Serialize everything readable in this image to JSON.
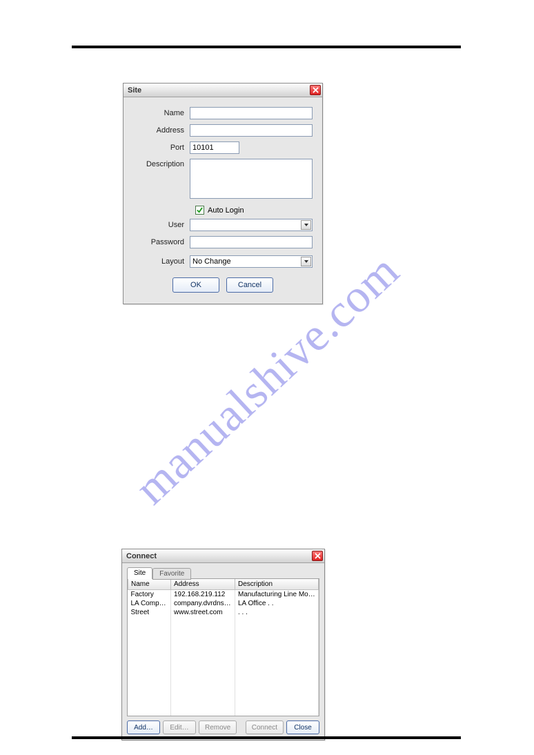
{
  "watermark": "manualshive.com",
  "site_dialog": {
    "title": "Site",
    "labels": {
      "name": "Name",
      "address": "Address",
      "port": "Port",
      "description": "Description",
      "user": "User",
      "password": "Password",
      "layout": "Layout"
    },
    "values": {
      "name": "",
      "address": "",
      "port": "10101",
      "description": "",
      "user": "",
      "password": "",
      "layout": "No Change"
    },
    "auto_login": {
      "label": "Auto Login",
      "checked": true
    },
    "buttons": {
      "ok": "OK",
      "cancel": "Cancel"
    }
  },
  "connect_dialog": {
    "title": "Connect",
    "tabs": {
      "site": "Site",
      "favorite": "Favorite"
    },
    "active_tab": "site",
    "columns": [
      "Name",
      "Address",
      "Description"
    ],
    "rows": [
      {
        "name": "Factory",
        "address": "192.168.219.112",
        "description": "Manufacturing Line Monitoring"
      },
      {
        "name": "LA Company",
        "address": "company.dvrdns.org",
        "description": "LA Office . ."
      },
      {
        "name": "Street",
        "address": "www.street.com",
        "description": ". . ."
      }
    ],
    "buttons": {
      "add": "Add…",
      "edit": "Edit…",
      "remove": "Remove",
      "connect": "Connect",
      "close": "Close"
    }
  }
}
